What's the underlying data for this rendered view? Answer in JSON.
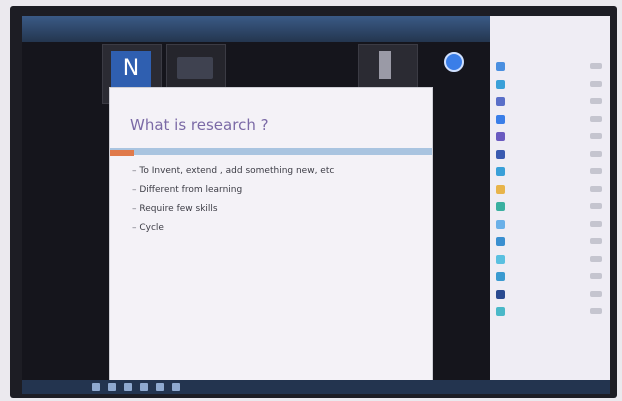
{
  "video": {
    "tile1_initial": "N",
    "tile1_name": "",
    "tile2_name": "",
    "name3": "",
    "name4": "",
    "tile5_name": ""
  },
  "slide": {
    "title": "What is research ?",
    "bullets": [
      "To Invent, extend , add something new, etc",
      "Different from learning",
      "Require few skills",
      "Cycle"
    ]
  },
  "participants": {
    "title": "",
    "subtitle": "",
    "avatar_colors": [
      "#4a8fe0",
      "#3aa0d8",
      "#5a6fc8",
      "#3a7ee8",
      "#6a5ac0",
      "#3a5ab0",
      "#3aa0d8",
      "#e8b44a",
      "#3ab0a0",
      "#6ab0e8",
      "#3a8fd0",
      "#5ac0e0",
      "#3a9ad0",
      "#2a4a90",
      "#4ab8c8"
    ]
  },
  "colors": {
    "accent": "#2f5fb0",
    "slide_bar": "#a9c4e0",
    "slide_accent": "#e07a4b",
    "title_text": "#7b6aa6"
  }
}
